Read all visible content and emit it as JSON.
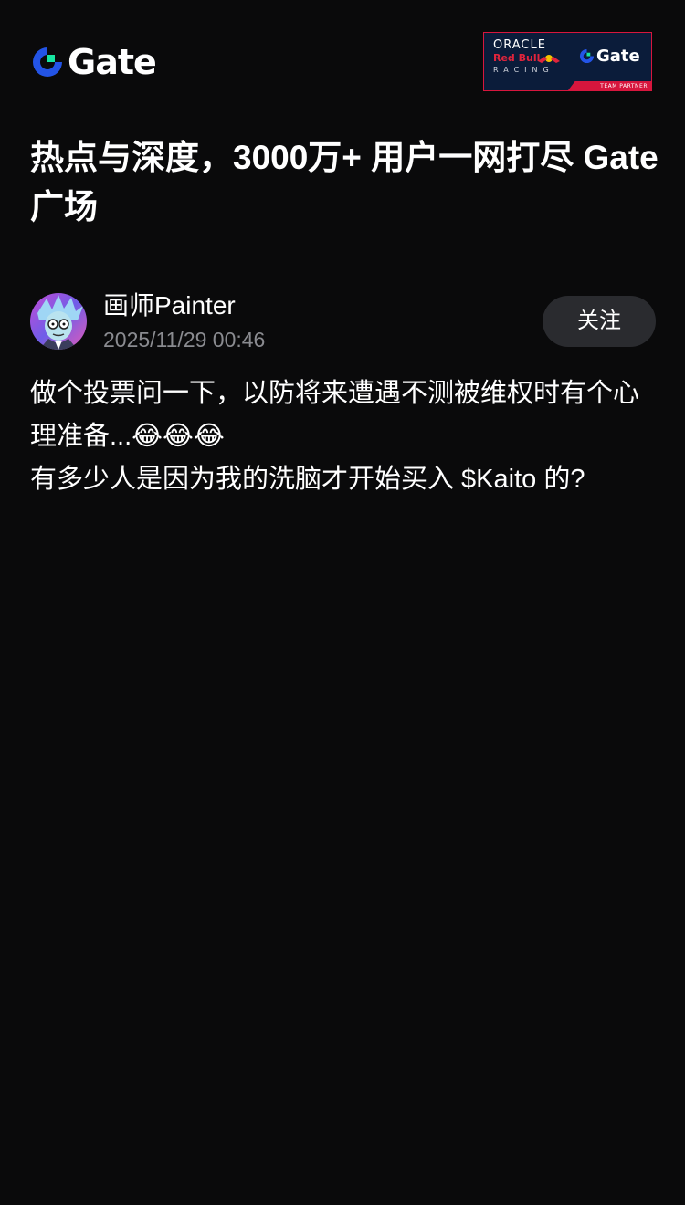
{
  "header": {
    "logo_text": "Gate",
    "partner_badge": {
      "line1": "ORACLE",
      "line2": "Red Bull",
      "line3": "RACING",
      "brand": "Gate",
      "strip": "TEAM PARTNER"
    }
  },
  "headline": "热点与深度，3000万+ 用户一网打尽 Gate 广场",
  "post": {
    "author": "画师Painter",
    "timestamp": "2025/11/29 00:46",
    "follow_label": "关注",
    "body_line1": "做个投票问一下，以防将来遭遇不测被维权时有个心理准备...😂😂😂",
    "body_line2": "有多少人是因为我的洗脑才开始买入 $Kaito 的?"
  },
  "colors": {
    "background": "#0a0a0b",
    "brand_blue": "#2354e6",
    "brand_green": "#17e6a1",
    "muted_text": "#8a8b90",
    "button_bg": "#2a2b2f"
  },
  "icons": [
    "gate-logo-icon",
    "avatar-image",
    "red-bull-icon"
  ]
}
